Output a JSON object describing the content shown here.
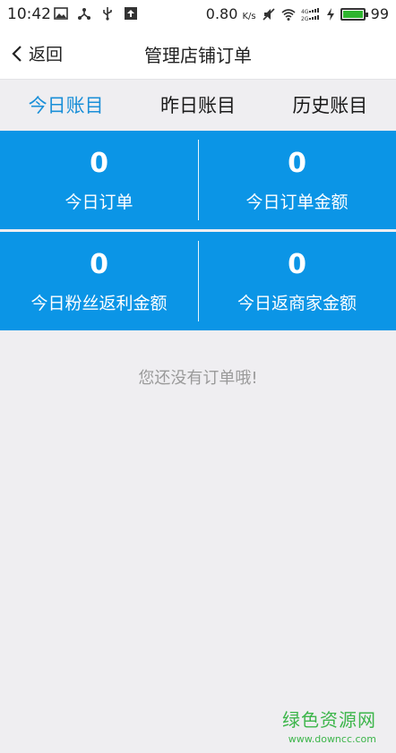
{
  "status_bar": {
    "time": "10:42",
    "speed": "0.80",
    "speed_unit": "K/s",
    "battery": "99"
  },
  "nav": {
    "back_label": "返回",
    "title": "管理店铺订单"
  },
  "tabs": [
    {
      "label": "今日账目",
      "active": true
    },
    {
      "label": "昨日账目",
      "active": false
    },
    {
      "label": "历史账目",
      "active": false
    }
  ],
  "stats": [
    {
      "value": "0",
      "label": "今日订单"
    },
    {
      "value": "0",
      "label": "今日订单金额"
    },
    {
      "value": "0",
      "label": "今日粉丝返利金额"
    },
    {
      "value": "0",
      "label": "今日返商家金额"
    }
  ],
  "empty_message": "您还没有订单哦!",
  "watermark": {
    "text": "绿色资源网",
    "url": "www.downcc.com"
  },
  "colors": {
    "accent": "#1a8fd8",
    "stat_bg": "#0b95e6",
    "page_bg": "#efeef1"
  }
}
